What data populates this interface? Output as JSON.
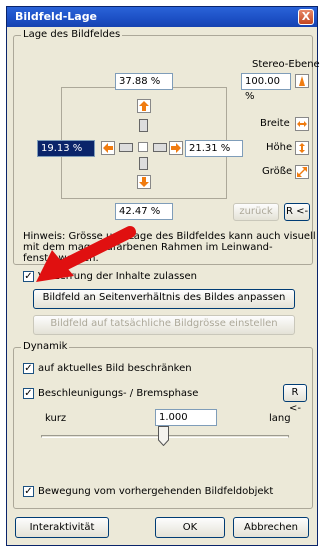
{
  "window": {
    "title": "Bildfeld-Lage",
    "close_glyph": "X"
  },
  "lage_group": {
    "legend": "Lage des Bildfeldes",
    "stereo_label": "Stereo-Ebene",
    "stereo_value": "100.00 %",
    "top_value": "37.88 %",
    "left_value": "19.13 %",
    "right_value": "21.31 %",
    "bottom_value": "42.47 %",
    "breite_label": "Breite",
    "hoehe_label": "Höhe",
    "groesse_label": "Größe",
    "zurueck_button": "zurück",
    "reset_button": "R <-",
    "hint_lines": [
      "Hinweis: Grösse und Lage des Bildfeldes kann auch visuell",
      "mit dem          magentafarbenen Rahmen im Leinwand-",
      "fenst          t werden."
    ],
    "distortion_checkbox": {
      "label": "Verzerrung der Inhalte zulassen",
      "checked": true
    },
    "fit_aspect_button": "Bildfeld an Seitenverhältnis des Bildes anpassen",
    "fit_size_button": "Bildfeld auf tatsächliche Bildgrösse einstellen"
  },
  "dynamik_group": {
    "legend": "Dynamik",
    "limit_checkbox": {
      "label": "auf aktuelles Bild beschränken",
      "checked": true
    },
    "accel_checkbox": {
      "label": "Beschleunigungs- / Bremsphase",
      "checked": true
    },
    "reset_button": "R <-",
    "short_label": "kurz",
    "long_label": "lang",
    "speed_value": "1.000",
    "slider_level": 0.47,
    "motion_checkbox": {
      "label": "Bewegung vom vorhergehenden Bildfeldobjekt",
      "checked": true
    }
  },
  "footer": {
    "interactivity_button": "Interaktivität",
    "ok_button": "OK",
    "cancel_button": "Abbrechen"
  },
  "colors": {
    "accent": "#f07c10",
    "titlebar": "#1c4fc4",
    "annotation_arrow": "#e01010"
  }
}
